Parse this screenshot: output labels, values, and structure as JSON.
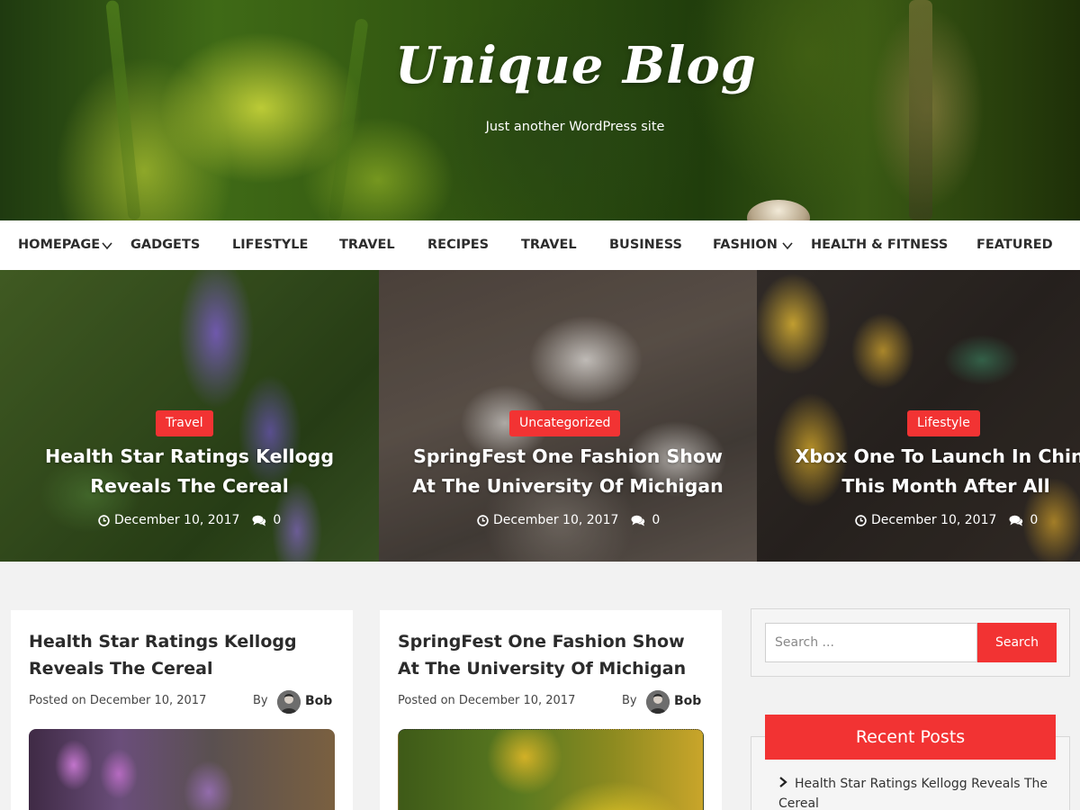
{
  "header": {
    "site_title": "Unique Blog",
    "tagline": "Just another WordPress site"
  },
  "nav": {
    "items": [
      {
        "label": "HOMEPAGE",
        "has_submenu": true
      },
      {
        "label": "GADGETS",
        "has_submenu": false
      },
      {
        "label": "LIFESTYLE",
        "has_submenu": false
      },
      {
        "label": "TRAVEL",
        "has_submenu": false
      },
      {
        "label": "RECIPES",
        "has_submenu": false
      },
      {
        "label": "TRAVEL",
        "has_submenu": false
      },
      {
        "label": "BUSINESS",
        "has_submenu": false
      },
      {
        "label": "FASHION",
        "has_submenu": true
      },
      {
        "label": "HEALTH & FITNESS",
        "has_submenu": false
      },
      {
        "label": "FEATURED",
        "has_submenu": false
      }
    ]
  },
  "slider": {
    "slides": [
      {
        "category": "Travel",
        "title_line1": "Health Star Ratings Kellogg",
        "title_line2": "Reveals The Cereal",
        "date": "December 10, 2017",
        "comments": "0"
      },
      {
        "category": "Uncategorized",
        "title_line1": "SpringFest One Fashion Show",
        "title_line2": "At The University Of Michigan",
        "date": "December 10, 2017",
        "comments": "0"
      },
      {
        "category": "Lifestyle",
        "title_line1": "Xbox One To Launch In China",
        "title_line2": "This Month After All",
        "date": "December 10, 2017",
        "comments": "0"
      }
    ]
  },
  "posts": [
    {
      "title": "Health Star Ratings Kellogg Reveals The Cereal",
      "posted_on": "Posted on December 10, 2017",
      "by": "By",
      "author": "Bob"
    },
    {
      "title": "SpringFest One Fashion Show At The University Of Michigan",
      "posted_on": "Posted on December 10, 2017",
      "by": "By",
      "author": "Bob"
    }
  ],
  "sidebar": {
    "search": {
      "placeholder": "Search ...",
      "button_label": "Search"
    },
    "recent_posts": {
      "heading": "Recent Posts",
      "items": [
        "Health Star Ratings Kellogg Reveals The Cereal"
      ]
    }
  },
  "colors": {
    "accent": "#f23333",
    "page_background": "#f2f2f2"
  },
  "icons": {
    "date": "clock-icon",
    "comments": "comments-icon",
    "submenu": "chevron-down-icon",
    "recent_item": "chevron-right-icon"
  }
}
